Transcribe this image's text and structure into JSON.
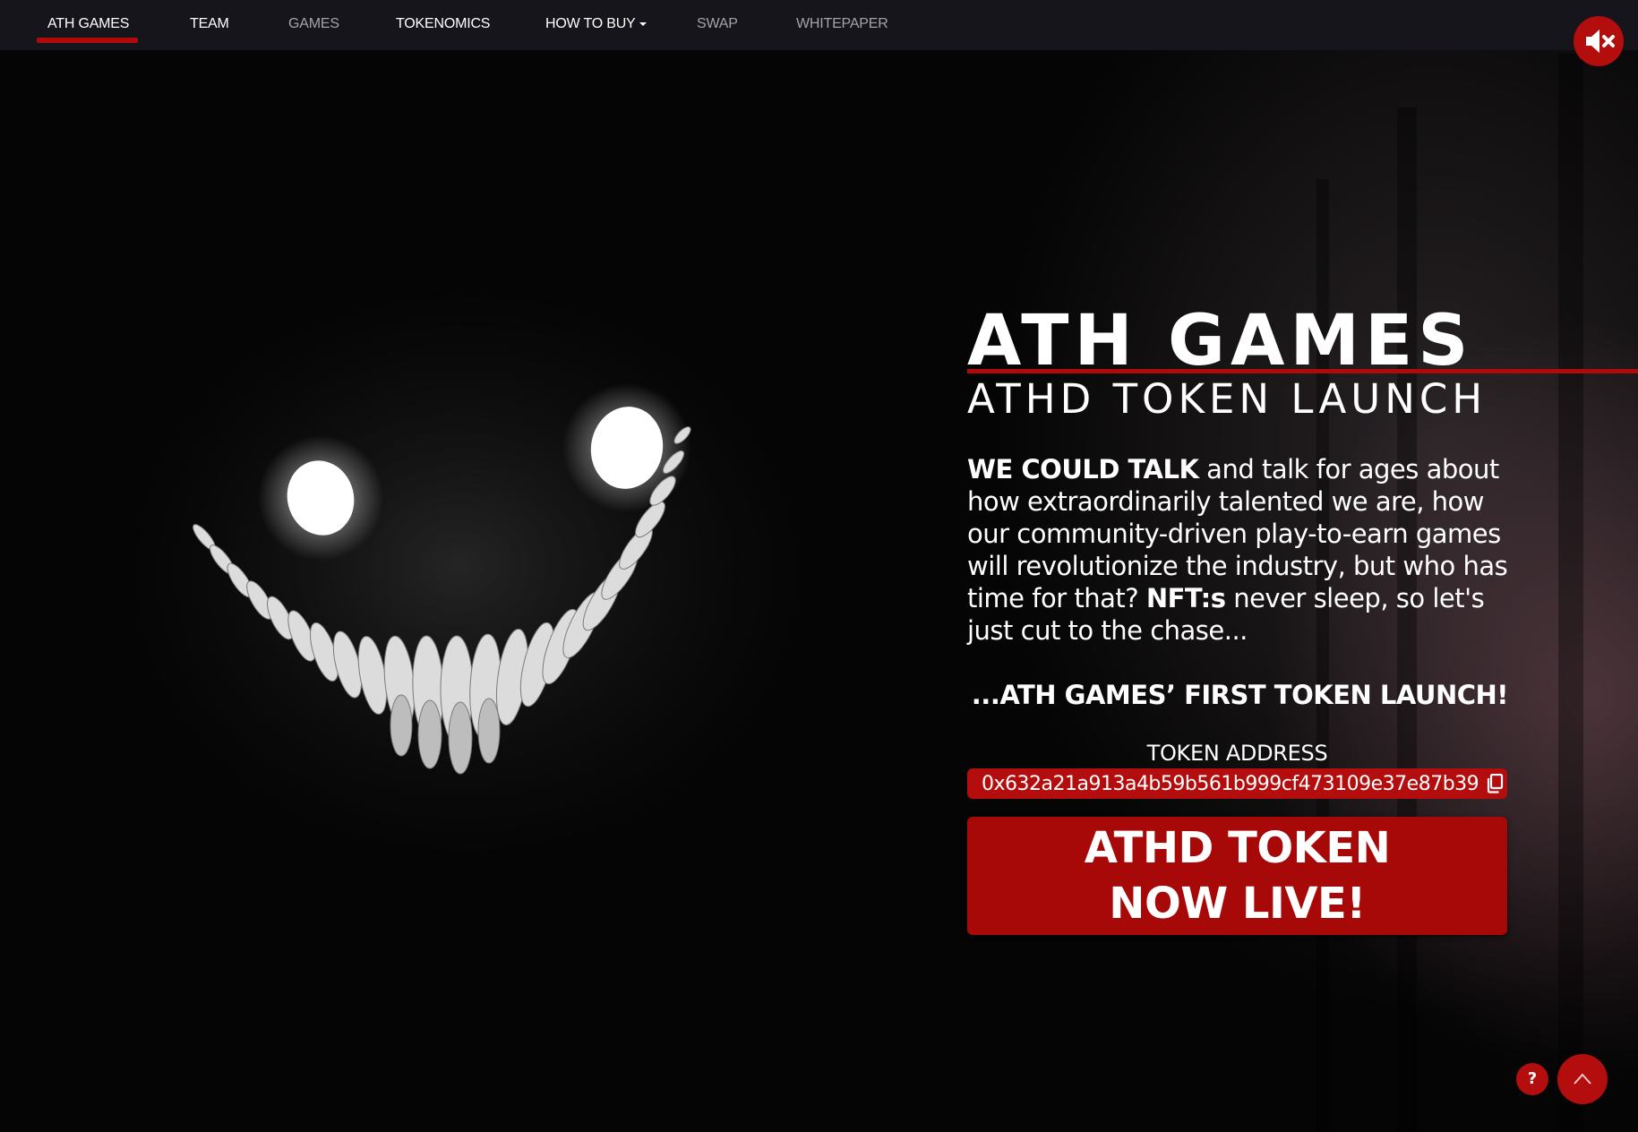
{
  "nav": {
    "items": [
      {
        "label": "ATH GAMES",
        "active": true
      },
      {
        "label": "TEAM"
      },
      {
        "label": "GAMES"
      },
      {
        "label": "TOKENOMICS"
      },
      {
        "label": "HOW TO BUY"
      },
      {
        "label": "SWAP"
      },
      {
        "label": "WHITEPAPER"
      }
    ],
    "mute_icon": "speaker-muted-icon"
  },
  "hero": {
    "title": "ATH GAMES",
    "subtitle": "ATHD TOKEN LAUNCH",
    "body_lead": "WE COULD TALK",
    "body_1": " and talk for ages about how extraordinarily talented we are, how our community-driven play-to-earn games will revolutionize the industry, but who has time for that? ",
    "body_nft": "NFT:s",
    "body_2": " never sleep, so let's just cut to the chase...",
    "tagline": "...ATH GAMES’ FIRST TOKEN LAUNCH!",
    "token_address_label": "TOKEN ADDRESS",
    "token_address": "0x632a21a913a4b59b561b999cf473109e37e87b39",
    "cta_line1": "ATHD TOKEN",
    "cta_line2": "NOW LIVE!"
  },
  "floating": {
    "help_label": "?",
    "scroll_top_icon": "chevron-up-icon"
  },
  "colors": {
    "accent": "#b30d0d",
    "navbar": "#15151b",
    "background": "#060606"
  }
}
